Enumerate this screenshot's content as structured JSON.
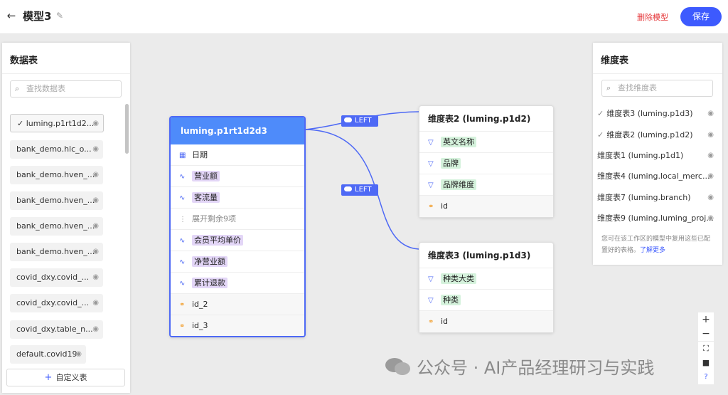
{
  "header": {
    "title": "模型3",
    "delete_label": "删除模型",
    "save_label": "保存"
  },
  "left_panel": {
    "title": "数据表",
    "search_placeholder": "查找数据表",
    "tables": [
      "luming.p1rt1d2...",
      "bank_demo.hlc_o...",
      "bank_demo.hven_...",
      "bank_demo.hven_...",
      "bank_demo.hven_...",
      "bank_demo.hven_...",
      "covid_dxy.covid_...",
      "covid_dxy.covid_...",
      "covid_dxy.table_n...",
      "default.covid19"
    ],
    "custom_label": "自定义表"
  },
  "right_panel": {
    "title": "维度表",
    "search_placeholder": "查找维度表",
    "tables": [
      "维度表3 (luming.p1d3)",
      "维度表2 (luming.p1d2)",
      "维度表1 (luming.p1d1)",
      "维度表4 (luming.local_merc...",
      "维度表7 (luming.branch)",
      "维度表9 (luming.luming_proj..."
    ],
    "note": "您可在该工作区的模型中复用这些已配置好的表格。",
    "note_link": "了解更多"
  },
  "main_card": {
    "title": "luming.p1rt1d2d3",
    "fields": [
      "日期",
      "营业额",
      "客流量",
      "展开剩余9项",
      "会员平均单价",
      "净营业额",
      "累计退款",
      "id_2",
      "id_3"
    ]
  },
  "dim_card_2": {
    "title": "维度表2 (luming.p1d2)",
    "fields": [
      "英文名称",
      "品牌",
      "品牌维度",
      "id"
    ]
  },
  "dim_card_3": {
    "title": "维度表3 (luming.p1d3)",
    "fields": [
      "种类大类",
      "种类",
      "id"
    ]
  },
  "joins": {
    "join1": "LEFT",
    "join2": "LEFT"
  },
  "zoom": {
    "plus": "+",
    "minus": "−"
  },
  "watermark": "公众号 · AI产品经理研习与实践",
  "colors": {
    "accent": "#3d5afe",
    "danger": "#e5383b",
    "header_blue": "#4e8bfa"
  }
}
